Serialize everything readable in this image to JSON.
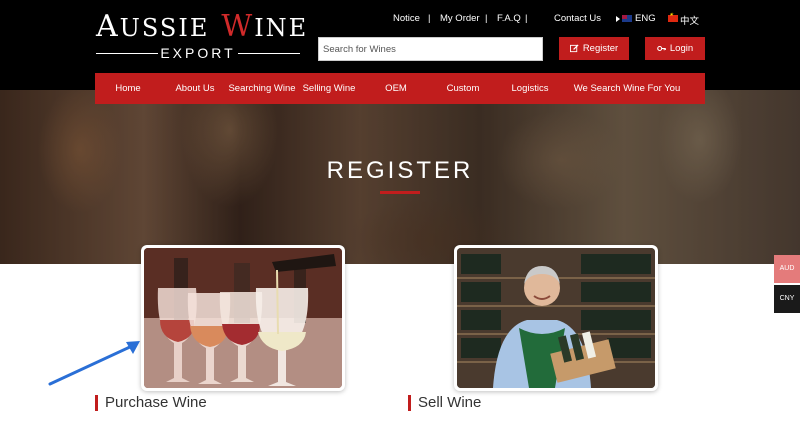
{
  "logo": {
    "word1_initial": "A",
    "word1_rest": "USSIE",
    "word2_initial": "W",
    "word2_rest": "INE",
    "sub": "EXPORT"
  },
  "top_links": {
    "notice": "Notice",
    "my_order": "My Order",
    "faq": "F.A.Q",
    "contact": "Contact Us",
    "lang_eng": "ENG",
    "lang_cn": "中文",
    "separator": "|"
  },
  "search": {
    "placeholder": "Search for Wines"
  },
  "auth": {
    "register": "Register",
    "login": "Login"
  },
  "nav": {
    "items": [
      "Home",
      "About Us",
      "Searching Wine",
      "Selling Wine",
      "OEM",
      "Custom",
      "Logistics",
      "We Search Wine For You"
    ]
  },
  "hero": {
    "title": "REGISTER"
  },
  "cards": {
    "purchase": {
      "label": "Purchase Wine"
    },
    "sell": {
      "label": "Sell Wine"
    }
  },
  "currency": {
    "aud": "AUD",
    "cny": "CNY"
  },
  "colors": {
    "brand_red": "#c11d1d",
    "header_bg": "#000000",
    "annotation_arrow": "#2a6fd6"
  }
}
